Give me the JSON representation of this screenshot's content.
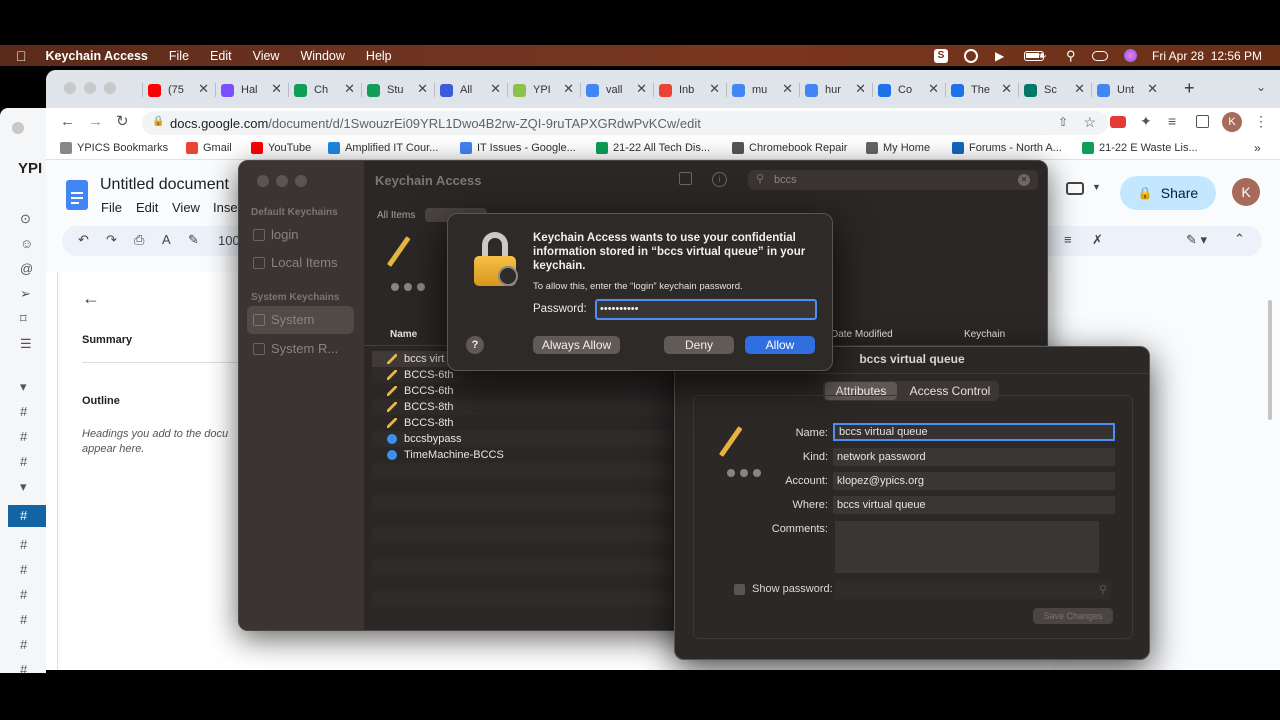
{
  "menubar": {
    "app_name": "Keychain Access",
    "items": [
      "File",
      "Edit",
      "View",
      "Window",
      "Help"
    ],
    "datetime": "Fri Apr 28  12:56 PM"
  },
  "browser": {
    "tabs": [
      {
        "label": "(75",
        "color": "#ff0000"
      },
      {
        "label": "Hal",
        "color": "#7c4dff"
      },
      {
        "label": "Ch",
        "color": "#0f9d58"
      },
      {
        "label": "Stu",
        "color": "#0f9d58"
      },
      {
        "label": "All",
        "color": "#3b5bdb"
      },
      {
        "label": "YPI",
        "color": "#8bc34a"
      },
      {
        "label": "vall",
        "color": "#4285f4"
      },
      {
        "label": "Inb",
        "color": "#ea4335"
      },
      {
        "label": "mu",
        "color": "#4285f4"
      },
      {
        "label": "hur",
        "color": "#4285f4"
      },
      {
        "label": "Co",
        "color": "#1a73e8"
      },
      {
        "label": "The",
        "color": "#1a73e8"
      },
      {
        "label": "Sc",
        "color": "#00796b"
      },
      {
        "label": "Unt",
        "color": "#4285f4"
      }
    ],
    "url_host": "docs.google.com",
    "url_path": "/document/d/1SwouzrEi09YRL1Dwo4B2rw-ZQI-9ruTAPXGRdwPvKCw/edit",
    "profile_initial": "K",
    "bookmarks": [
      {
        "label": "YPICS Bookmarks",
        "color": "#888888"
      },
      {
        "label": "Gmail",
        "color": "#ea4335"
      },
      {
        "label": "YouTube",
        "color": "#ff0000"
      },
      {
        "label": "Amplified IT Cour...",
        "color": "#1e88e5"
      },
      {
        "label": "IT Issues - Google...",
        "color": "#4285f4"
      },
      {
        "label": "21-22 All Tech Dis...",
        "color": "#0f9d58"
      },
      {
        "label": "Chromebook Repair",
        "color": "#555555"
      },
      {
        "label": "My Home",
        "color": "#666666"
      },
      {
        "label": "Forums - North A...",
        "color": "#1565c0"
      },
      {
        "label": "21-22 E Waste Lis...",
        "color": "#0f9d58"
      }
    ]
  },
  "docs": {
    "title": "Untitled document",
    "menu": [
      "File",
      "Edit",
      "View",
      "Inse"
    ],
    "zoom": "100",
    "share_label": "Share",
    "avatar_initial": "K",
    "summary_label": "Summary",
    "outline_label": "Outline",
    "outline_hint_1": "Headings you add to the docu",
    "outline_hint_2": "appear here."
  },
  "left_window": {
    "title_fragment": "YPI"
  },
  "keychain": {
    "title": "Keychain Access",
    "search_value": "bccs",
    "sidebar": {
      "default_header": "Default Keychains",
      "system_header": "System Keychains",
      "items": [
        "login",
        "Local Items",
        "System",
        "System R..."
      ]
    },
    "filter_all": "All Items",
    "col_name": "Name",
    "col_modified": "Date Modified",
    "col_keychain": "Keychain",
    "rows": [
      {
        "label": "bccs virt",
        "kind": "pencil"
      },
      {
        "label": "BCCS-6th",
        "kind": "pencil"
      },
      {
        "label": "BCCS-6th",
        "kind": "pencil"
      },
      {
        "label": "BCCS-8th",
        "kind": "pencil"
      },
      {
        "label": "BCCS-8th",
        "kind": "pencil"
      },
      {
        "label": "bccsbypass",
        "kind": "globe"
      },
      {
        "label": "TimeMachine-BCCS",
        "kind": "globe"
      }
    ]
  },
  "info_window": {
    "title": "bccs virtual queue",
    "tabs": [
      "Attributes",
      "Access Control"
    ],
    "fields": {
      "name_label": "Name:",
      "name_value": "bccs virtual queue",
      "kind_label": "Kind:",
      "kind_value": "network password",
      "account_label": "Account:",
      "account_value": "klopez@ypics.org",
      "where_label": "Where:",
      "where_value": "bccs virtual queue",
      "comments_label": "Comments:"
    },
    "show_password_label": "Show password:",
    "save_label": "Save Changes"
  },
  "dialog": {
    "heading": "Keychain Access wants to use your confidential information stored in “bccs virtual queue” in your keychain.",
    "subtext": "To allow this, enter the “login” keychain password.",
    "password_label": "Password:",
    "password_value": "••••••••••",
    "help_label": "?",
    "always_allow": "Always Allow",
    "deny": "Deny",
    "allow": "Allow"
  },
  "colors": {
    "accent_blue": "#2f6fe0",
    "dialog_bg": "#2e2a28"
  }
}
